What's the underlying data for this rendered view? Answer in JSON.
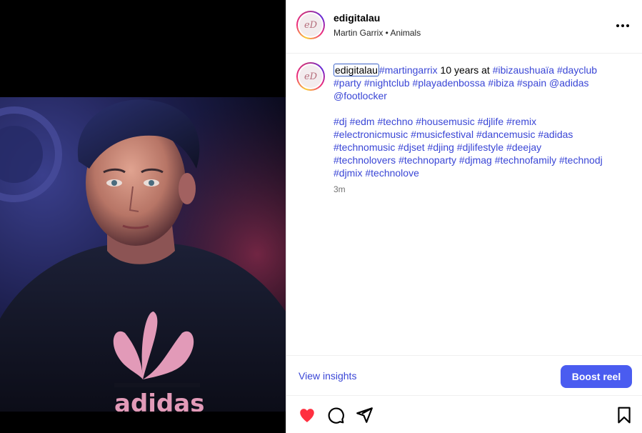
{
  "post": {
    "username": "edigitalau",
    "avatar_initials": "eD",
    "subtitle": "Martin Garrix • Animals"
  },
  "caption": {
    "username": "edigitalau",
    "line1_tag1": "#martingarrix",
    "line1_text": " 10 years at ",
    "line1_tag2": "#ibizaushuaïa",
    "line1_tag3": "#dayclub",
    "line2_tag1": "#party",
    "line2_tag2": "#nightclub",
    "line2_tag3": "#playadenbossa",
    "line2_tag4": "#ibiza",
    "line2_tag5": "#spain",
    "line2_tag6": "@adidas",
    "line3_tag1": "@footlocker",
    "hashtags": [
      "#dj",
      "#edm",
      "#techno",
      "#housemusic",
      "#djlife",
      "#remix",
      "#electronicmusic",
      "#musicfestival",
      "#dancemusic",
      "#adidas",
      "#technomusic",
      "#djset",
      "#djing",
      "#djlifestyle",
      "#deejay",
      "#technolovers",
      "#technoparty",
      "#djmag",
      "#technofamily",
      "#technodj",
      "#djmix",
      "#technolove"
    ],
    "time": "3m"
  },
  "actions": {
    "insights_label": "View insights",
    "boost_label": "Boost reel"
  },
  "icons": {
    "more": "more-options-icon",
    "like": "heart-icon",
    "comment": "comment-icon",
    "share": "share-icon",
    "save": "bookmark-icon"
  },
  "colors": {
    "link": "#3a46d6",
    "boost_button": "#4a5cf0",
    "heart": "#ff3040"
  },
  "media": {
    "shirt_logo_text": "adidas"
  }
}
